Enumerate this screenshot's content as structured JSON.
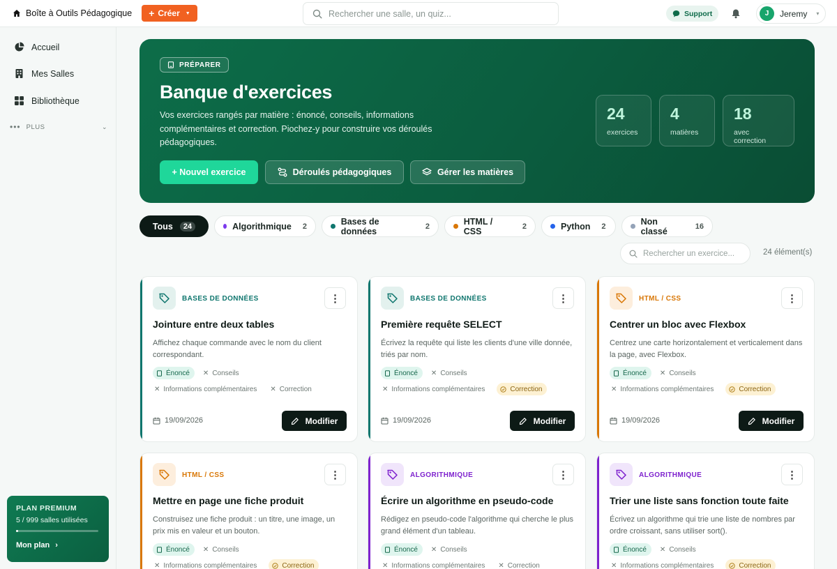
{
  "topbar": {
    "brand": "Boîte à Outils Pédagogique",
    "create_label": "Créer",
    "search_placeholder": "Rechercher une salle, un quiz...",
    "support_label": "Support",
    "user_initial": "J",
    "user_name": "Jeremy"
  },
  "sidebar": {
    "items": [
      {
        "label": "Accueil",
        "icon": "dashboard-icon"
      },
      {
        "label": "Mes Salles",
        "icon": "building-icon"
      },
      {
        "label": "Bibliothèque",
        "icon": "grid-icon"
      }
    ],
    "more_label": "PLUS",
    "premium": {
      "title": "PLAN PREMIUM",
      "usage": "5 / 999 salles utilisées",
      "usage_fraction": 0.005,
      "link": "Mon plan"
    }
  },
  "hero": {
    "badge": "PRÉPARER",
    "title": "Banque d'exercices",
    "description": "Vos exercices rangés par matière : énoncé, conseils, informations complémentaires et correction. Piochez-y pour construire vos déroulés pédagogiques.",
    "buttons": {
      "new": "+ Nouvel exercice",
      "sequences": "Déroulés pédagogiques",
      "subjects": "Gérer les matières"
    },
    "stats": [
      {
        "value": "24",
        "label": "exercices"
      },
      {
        "value": "4",
        "label": "matières"
      },
      {
        "value": "18",
        "label": "avec correction"
      }
    ]
  },
  "filters": [
    {
      "label": "Tous",
      "count": "24",
      "color": ""
    },
    {
      "label": "Algorithmique",
      "count": "2",
      "color": "#7c3aed"
    },
    {
      "label": "Bases de données",
      "count": "2",
      "color": "#0f766e"
    },
    {
      "label": "HTML / CSS",
      "count": "2",
      "color": "#d97706"
    },
    {
      "label": "Python",
      "count": "2",
      "color": "#2563eb"
    },
    {
      "label": "Non classé",
      "count": "16",
      "color": "#94a3b8"
    }
  ],
  "exercise_search_placeholder": "Rechercher un exercice...",
  "element_count": "24 élément(s)",
  "tag_labels": {
    "statement": "Énoncé",
    "tips": "Conseils",
    "info": "Informations complémentaires",
    "correction": "Correction"
  },
  "edit_label": "Modifier",
  "subject_colors": {
    "db": "#0f766e",
    "html": "#d97706",
    "algo": "#7e22ce"
  },
  "cards": [
    {
      "subject": "BASES DE DONNÉES",
      "title": "Jointure entre deux tables",
      "description": "Affichez chaque commande avec le nom du client correspondant.",
      "date": "19/09/2026"
    },
    {
      "subject": "BASES DE DONNÉES",
      "title": "Première requête SELECT",
      "description": "Écrivez la requête qui liste les clients d'une ville donnée, triés par nom.",
      "date": "19/09/2026"
    },
    {
      "subject": "HTML / CSS",
      "title": "Centrer un bloc avec Flexbox",
      "description": "Centrez une carte horizontalement et verticalement dans la page, avec Flexbox.",
      "date": "19/09/2026"
    },
    {
      "subject": "HTML / CSS",
      "title": "Mettre en page une fiche produit",
      "description": "Construisez une fiche produit : un titre, une image, un prix mis en valeur et un bouton.",
      "date": ""
    },
    {
      "subject": "ALGORITHMIQUE",
      "title": "Écrire un algorithme en pseudo-code",
      "description": "Rédigez en pseudo-code l'algorithme qui cherche le plus grand élément d'un tableau.",
      "date": ""
    },
    {
      "subject": "ALGORITHMIQUE",
      "title": "Trier une liste sans fonction toute faite",
      "description": "Écrivez un algorithme qui trie une liste de nombres par ordre croissant, sans utiliser sort().",
      "date": ""
    }
  ]
}
